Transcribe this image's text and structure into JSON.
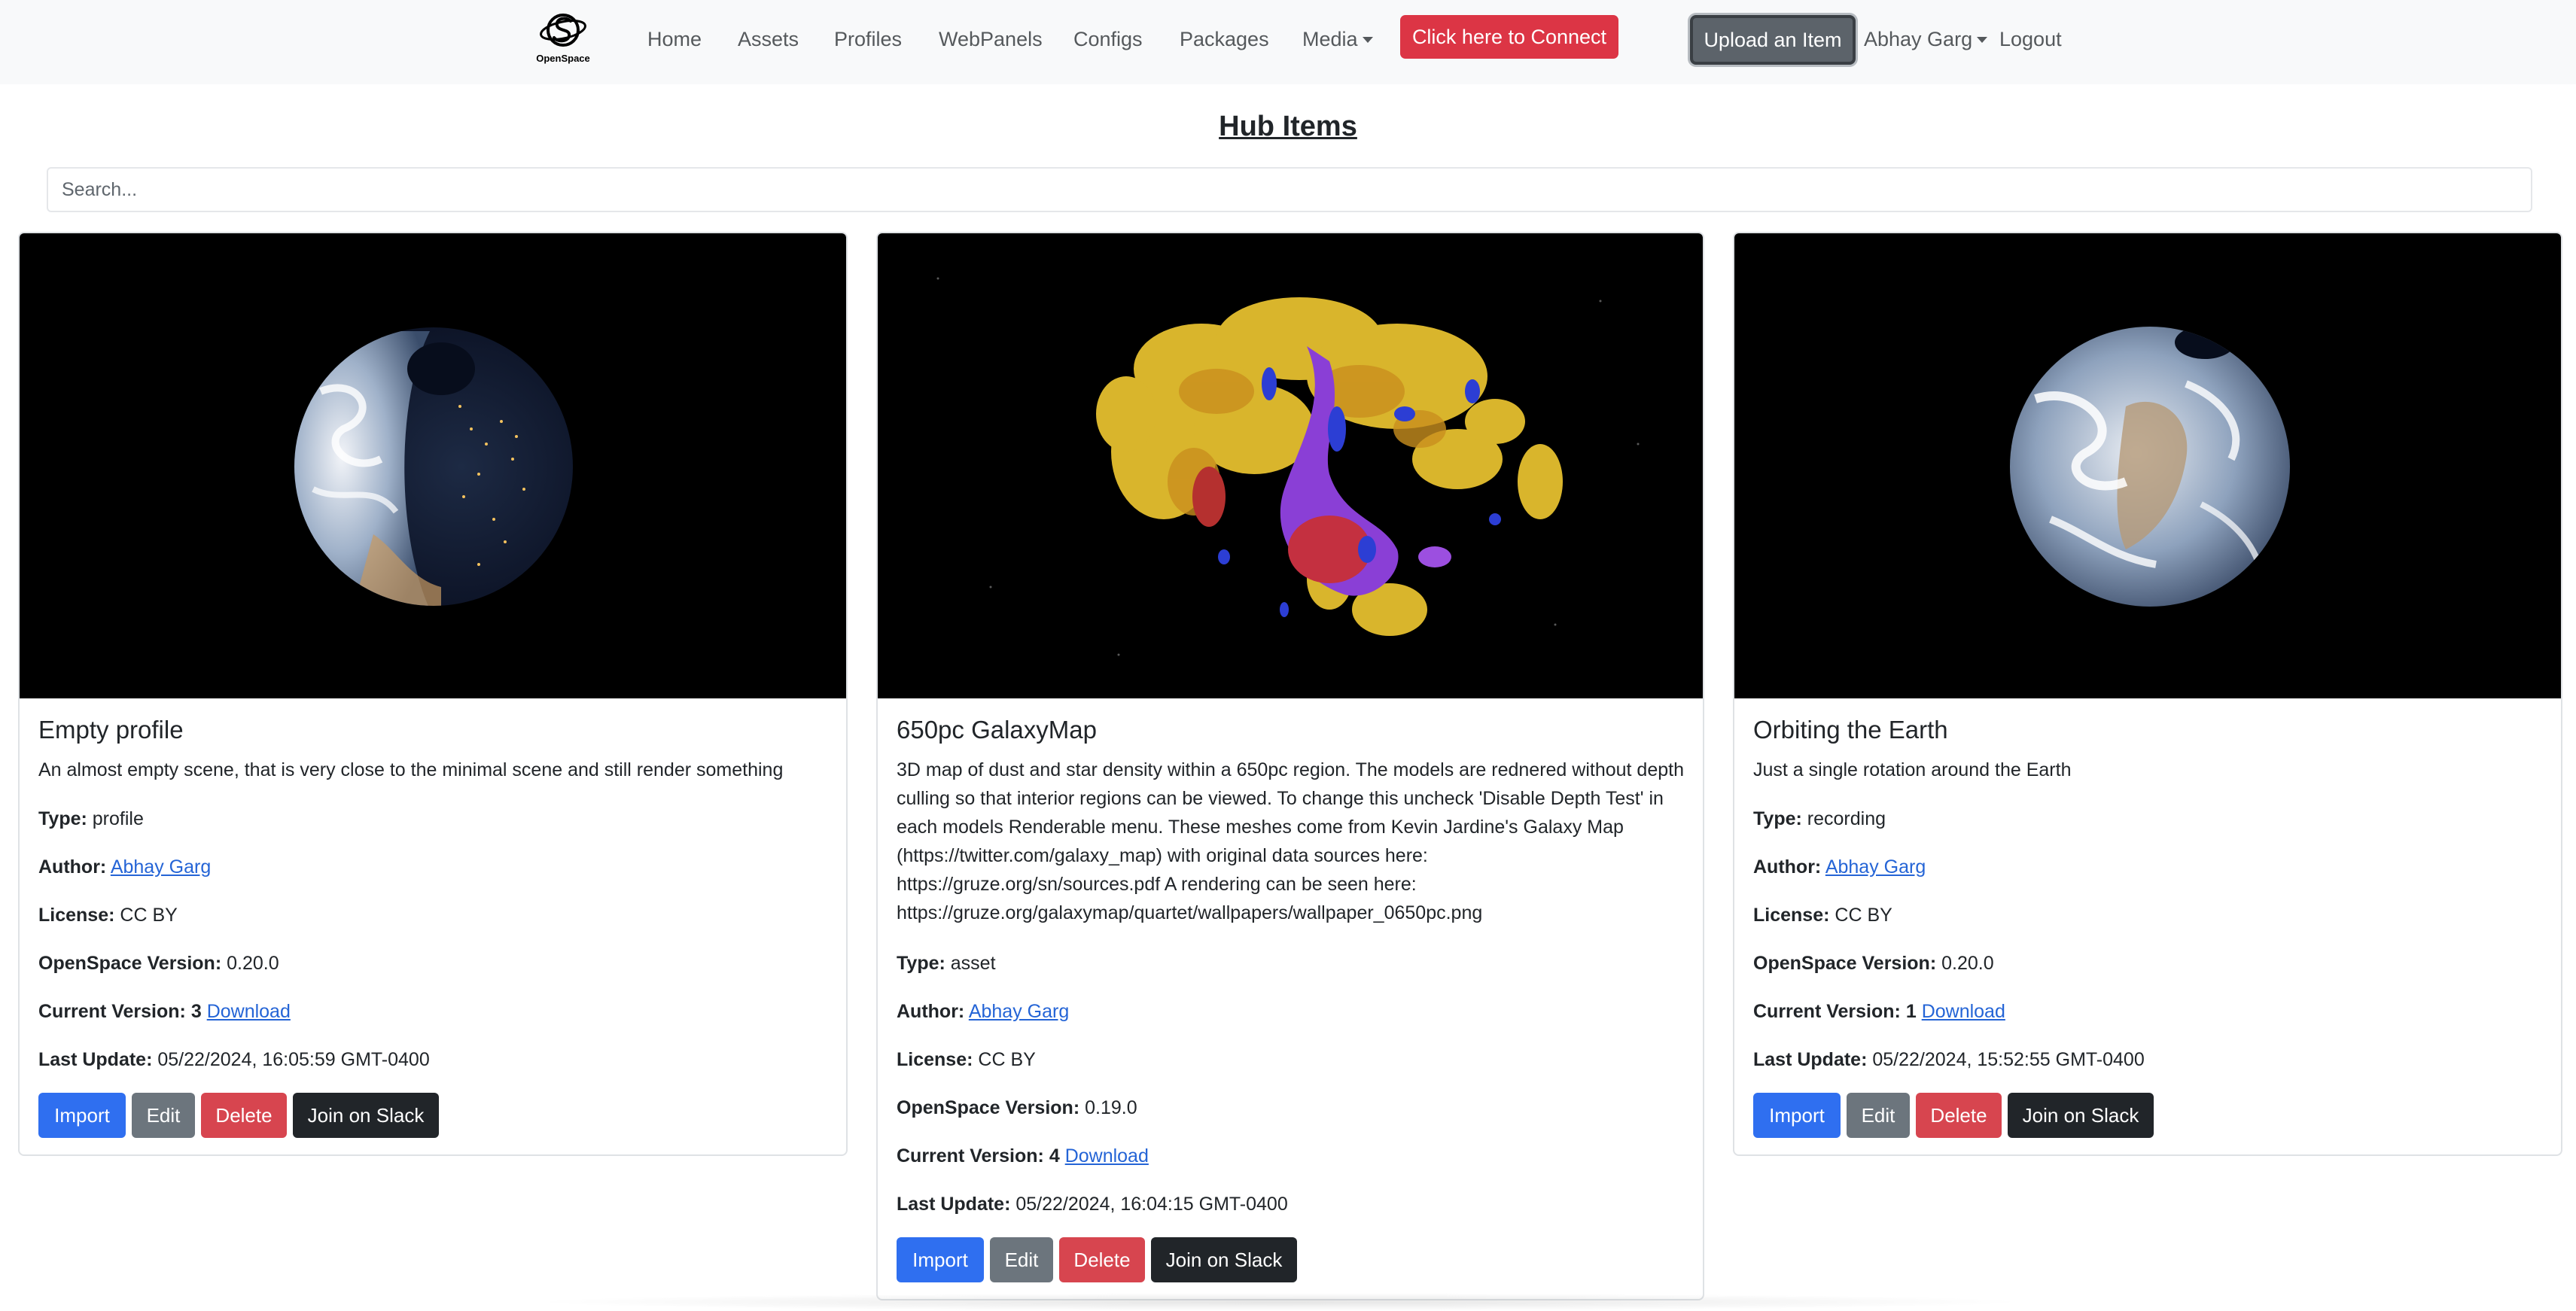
{
  "navbar": {
    "logo_text": "OpenSpace",
    "links": [
      "Home",
      "Assets",
      "Profiles",
      "WebPanels",
      "Configs",
      "Packages"
    ],
    "media_label": "Media",
    "connect_label": "Click here to Connect",
    "upload_label": "Upload an Item",
    "user_label": "Abhay Garg",
    "logout_label": "Logout"
  },
  "page": {
    "title": "Hub Items",
    "search_placeholder": "Search..."
  },
  "labels": {
    "type": "Type:",
    "author": "Author:",
    "license": "License:",
    "openspace_version": "OpenSpace Version:",
    "current_version": "Current Version:",
    "last_update": "Last Update:",
    "download": "Download",
    "import": "Import",
    "edit": "Edit",
    "delete": "Delete",
    "slack": "Join on Slack"
  },
  "cards": [
    {
      "title": "Empty profile",
      "description": "An almost empty scene, that is very close to the minimal scene and still render something",
      "type": "profile",
      "author": "Abhay Garg",
      "license": "CC BY",
      "openspace_version": "0.20.0",
      "current_version": "3",
      "last_update": "05/22/2024, 16:05:59 GMT-0400",
      "image_icon": "earth-day-night-image"
    },
    {
      "title": "650pc GalaxyMap",
      "description": "3D map of dust and star density within a 650pc region. The models are rednered without depth culling so that interior regions can be viewed. To change this uncheck 'Disable Depth Test' in each models Renderable menu. These meshes come from Kevin Jardine's Galaxy Map (https://twitter.com/galaxy_map) with original data sources here: https://gruze.org/sn/sources.pdf A rendering can be seen here: https://gruze.org/galaxymap/quartet/wallpapers/wallpaper_0650pc.png",
      "type": "asset",
      "author": "Abhay Garg",
      "license": "CC BY",
      "openspace_version": "0.19.0",
      "current_version": "4",
      "last_update": "05/22/2024, 16:04:15 GMT-0400",
      "image_icon": "galaxy-dust-map-image"
    },
    {
      "title": "Orbiting the Earth",
      "description": "Just a single rotation around the Earth",
      "type": "recording",
      "author": "Abhay Garg",
      "license": "CC BY",
      "openspace_version": "0.20.0",
      "current_version": "1",
      "last_update": "05/22/2024, 15:52:55 GMT-0400",
      "image_icon": "earth-globe-image"
    }
  ],
  "colors": {
    "primary": "#2f6ff0",
    "secondary": "#6c757d",
    "danger": "#d7454f",
    "dark": "#212529",
    "link": "#2464d6",
    "navbar_bg": "#f8f9fa"
  }
}
